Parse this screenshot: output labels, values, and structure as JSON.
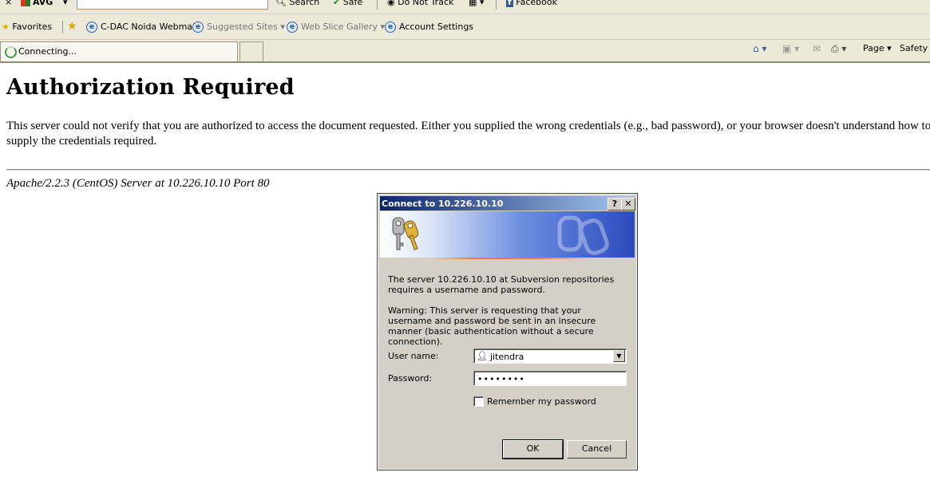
{
  "avg_toolbar": {
    "close": "×",
    "brand": "AVG",
    "dropdown": "▾",
    "search_value": "",
    "search_label": "Search",
    "safe_label": "Safe",
    "do_not_track_label": "Do Not Track",
    "facebook_label": "Facebook"
  },
  "favorites_bar": {
    "favorites_label": "Favorites",
    "items": [
      {
        "label": "C-DAC Noida Webmail"
      },
      {
        "label": "Suggested Sites ▾"
      },
      {
        "label": "Web Slice Gallery ▾"
      },
      {
        "label": "Account Settings"
      }
    ]
  },
  "tab": {
    "label": "Connecting..."
  },
  "command_bar": {
    "page_label": "Page ▾",
    "safety_label": "Safety ▾"
  },
  "page": {
    "heading": "Authorization Required",
    "message": "This server could not verify that you are authorized to access the document requested. Either you supplied the wrong credentials (e.g., bad password), or your browser doesn't understand how to supply the credentials required.",
    "server_signature": "Apache/2.2.3 (CentOS) Server at 10.226.10.10 Port 80"
  },
  "dialog": {
    "title": "Connect to 10.226.10.10",
    "help_button": "?",
    "close_button": "✕",
    "intro": "The server 10.226.10.10 at Subversion repositories requires a username and password.",
    "warning": "Warning: This server is requesting that your username and password be sent in an insecure manner (basic authentication without a secure connection).",
    "username_label": "User name:",
    "username_value": "jitendra",
    "password_label": "Password:",
    "password_value": "••••••••",
    "remember_label": "Remember my password",
    "remember_checked": false,
    "ok_label": "OK",
    "cancel_label": "Cancel"
  }
}
